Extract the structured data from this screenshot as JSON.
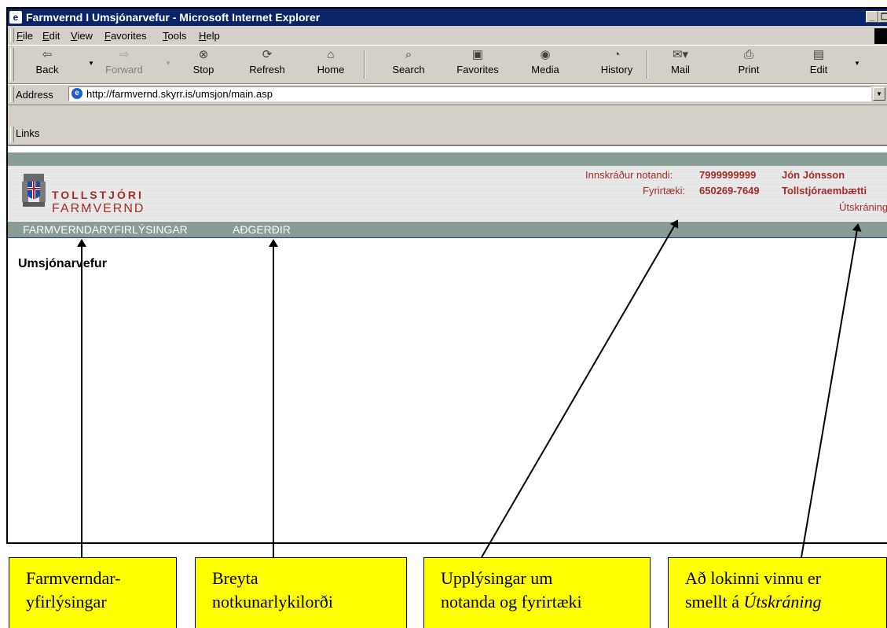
{
  "window": {
    "title": "Farmvernd I Umsjónarvefur - Microsoft Internet Explorer",
    "minimize_glyph": "_",
    "restore_glyph": "❐"
  },
  "menu": [
    "File",
    "Edit",
    "View",
    "Favorites",
    "Tools",
    "Help"
  ],
  "toolbar": {
    "back": "Back",
    "forward": "Forward",
    "stop": "Stop",
    "refresh": "Refresh",
    "home": "Home",
    "search": "Search",
    "favorites": "Favorites",
    "media": "Media",
    "history": "History",
    "mail": "Mail",
    "print": "Print",
    "edit": "Edit"
  },
  "address": {
    "label": "Address",
    "url": "http://farmvernd.skyrr.is/umsjon/main.asp"
  },
  "links_label": "Links",
  "site": {
    "logo_line1": "TOLLSTJÓRI",
    "logo_line2": "FARMVERND",
    "user_label": "Innskráður notandi:",
    "user_id": "7999999999",
    "user_name": "Jón Jónsson",
    "company_label": "Fyrirtæki:",
    "company_id": "650269-7649",
    "company_name": "Tollstjóraembætti",
    "logout": "Útskráning",
    "nav": [
      "FARMVERNDARYFIRLÝSINGAR",
      "AÐGERÐIR"
    ],
    "page_title": "Umsjónarvefur",
    "colors": {
      "brand_red": "#a52a2a",
      "nav_bg": "#8a9c96"
    }
  },
  "annotations": [
    [
      "Farmverndar-",
      "yfirlýsingar"
    ],
    [
      "Breyta",
      "notkunarlykilorði"
    ],
    [
      "Upplýsingar um",
      "notanda og fyrirtæki"
    ],
    [
      "Að lokinni vinnu er",
      "smellt á ",
      "Útskráning"
    ]
  ]
}
